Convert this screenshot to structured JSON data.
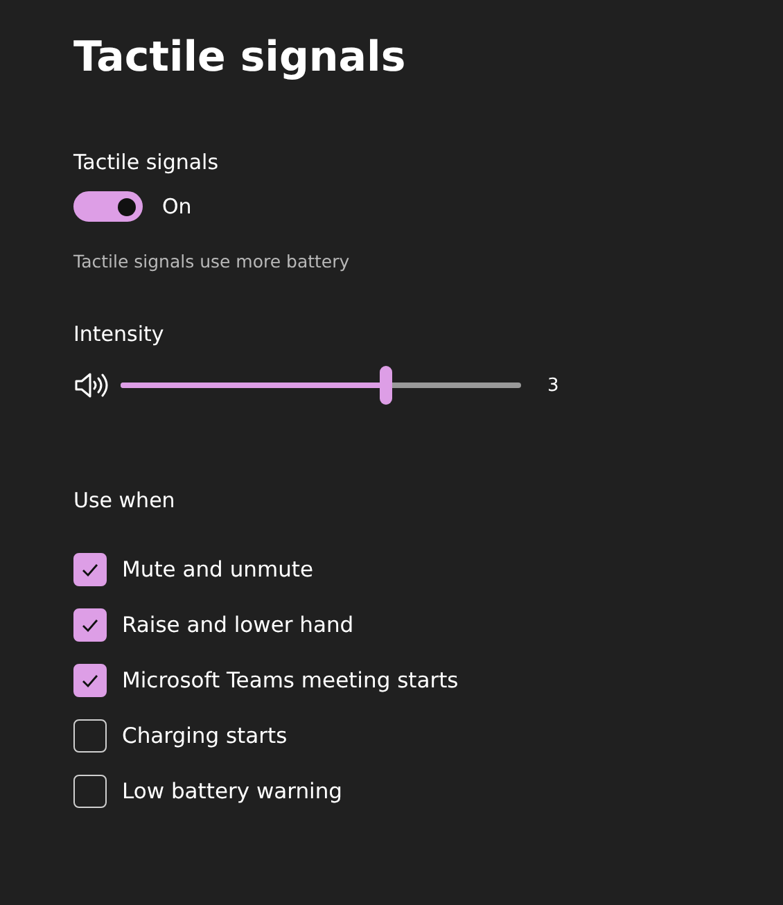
{
  "title": "Tactile signals",
  "toggle": {
    "label": "Tactile signals",
    "on": true,
    "state_text": "On"
  },
  "note": "Tactile signals use more battery",
  "intensity": {
    "label": "Intensity",
    "level": 0.66,
    "reading": "3"
  },
  "use_when": {
    "label": "Use when",
    "options": [
      {
        "label": "Mute and unmute",
        "checked": true
      },
      {
        "label": "Raise and lower hand",
        "checked": true
      },
      {
        "label": "Microsoft Teams meeting starts",
        "checked": true
      },
      {
        "label": "Charging starts",
        "checked": false
      },
      {
        "label": "Low battery warning",
        "checked": false
      }
    ]
  }
}
